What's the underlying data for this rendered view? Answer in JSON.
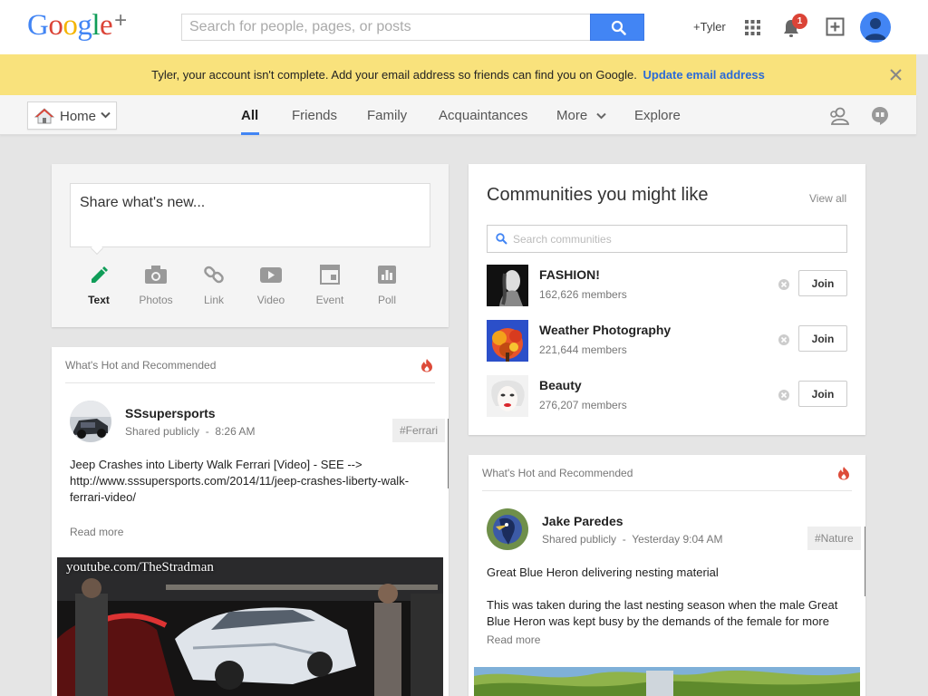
{
  "header": {
    "logo_text": "Google",
    "logo_plus": "+",
    "search_placeholder": "Search for people, pages, or posts",
    "user_label": "+Tyler",
    "notification_count": "1"
  },
  "notice": {
    "message": "Tyler, your account isn't complete. Add your email address so friends can find you on Google.",
    "link": "Update email address",
    "bg_color": "#f9e27c"
  },
  "nav": {
    "home_label": "Home",
    "tabs": [
      "All",
      "Friends",
      "Family",
      "Acquaintances",
      "More",
      "Explore"
    ],
    "active_tab": "All"
  },
  "share": {
    "prompt": "Share what's new...",
    "tools": [
      "Text",
      "Photos",
      "Link",
      "Video",
      "Event",
      "Poll"
    ],
    "active_tool": "Text"
  },
  "communities": {
    "title": "Communities you might like",
    "view_all": "View all",
    "search_placeholder": "Search communities",
    "join_label": "Join",
    "items": [
      {
        "name": "FASHION!",
        "members": "162,626 members"
      },
      {
        "name": "Weather Photography",
        "members": "221,644 members"
      },
      {
        "name": "Beauty",
        "members": "276,207 members"
      }
    ]
  },
  "posts": [
    {
      "section": "What's Hot and Recommended",
      "author": "SSsupersports",
      "visibility": "Shared publicly",
      "time": "8:26 AM",
      "tag": "#Ferrari",
      "body": "Jeep Crashes into Liberty Walk Ferrari [Video] - SEE --> http://www.sssupersports.com/2014/11/jeep-crashes-liberty-walk-ferrari-video/",
      "read_more": "Read more",
      "image_caption": "youtube.com/TheStradman"
    },
    {
      "section": "What's Hot and Recommended",
      "author": "Jake Paredes",
      "visibility": "Shared publicly",
      "time": "Yesterday 9:04 AM",
      "tag": "#Nature",
      "title_line": "Great Blue Heron delivering nesting material",
      "body": "This was taken during the last nesting season when the male Great Blue Heron was kept busy by the demands of the female for more",
      "read_more": "Read more"
    }
  ],
  "colors": {
    "accent_blue": "#4285f4",
    "link_blue": "#2a6ad8",
    "alert_red": "#db4437",
    "fire_red": "#dd4b39"
  }
}
